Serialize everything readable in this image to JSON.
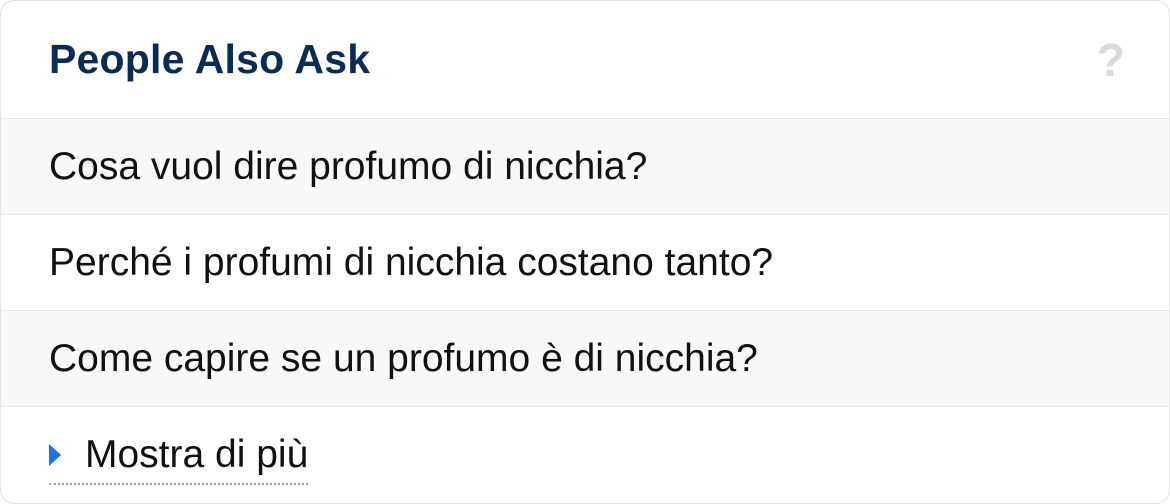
{
  "header": {
    "title": "People Also Ask",
    "help_icon": "?"
  },
  "questions": [
    {
      "label": "Cosa vuol dire profumo di nicchia?"
    },
    {
      "label": "Perché i profumi di nicchia costano tanto?"
    },
    {
      "label": "Come capire se un profumo è di nicchia?"
    }
  ],
  "more": {
    "label": "Mostra di più",
    "icon": "caret-right-icon"
  },
  "colors": {
    "title": "#0b2b57",
    "accent": "#1a73e8",
    "row_shade": "#f8f8f8"
  }
}
